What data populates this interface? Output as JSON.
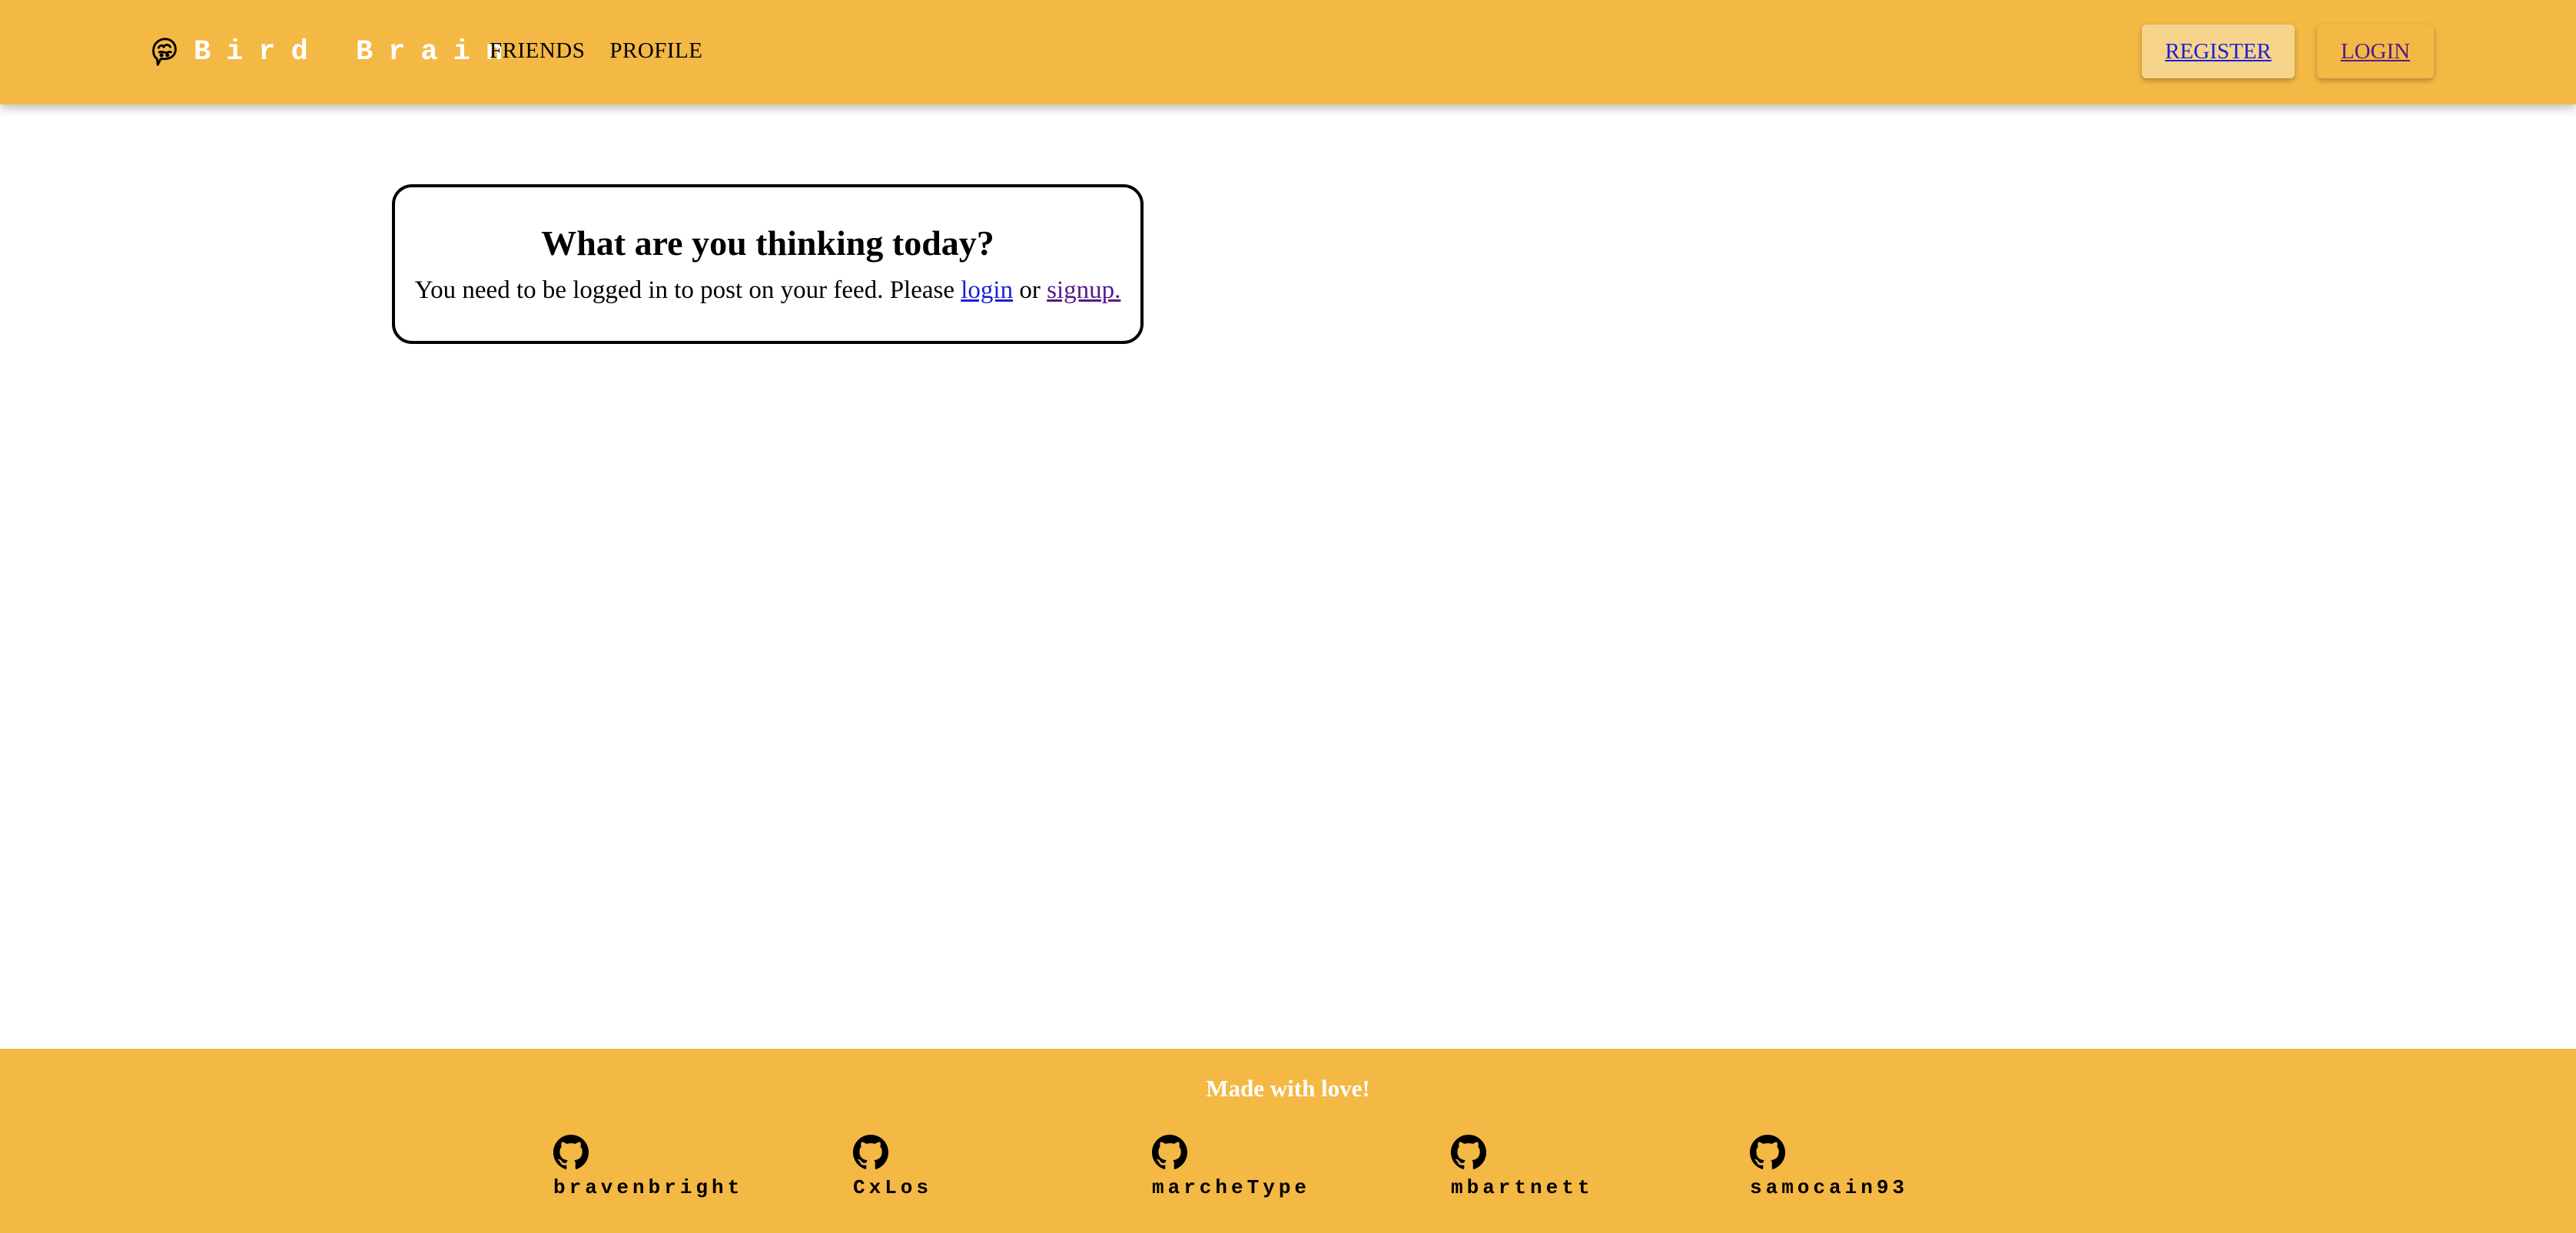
{
  "header": {
    "brand_name": "Bird Brain",
    "brand_icon": "bird-brain-logo-icon",
    "nav_links": [
      "FRIENDS",
      "PROFILE"
    ],
    "register_label": "REGISTER",
    "login_label": "LOGIN"
  },
  "main": {
    "card_title": "What are you thinking today?",
    "card_text": "You need to be logged in to post on your feed. Please",
    "login_link": "login",
    "or_text": "or",
    "signup_link": "signup."
  },
  "footer": {
    "title": "Made with love!",
    "contributors": [
      {
        "name": "bravenbright",
        "icon": "github-icon"
      },
      {
        "name": "CxLos",
        "icon": "github-icon"
      },
      {
        "name": "marcheType",
        "icon": "github-icon"
      },
      {
        "name": "mbartnett",
        "icon": "github-icon"
      },
      {
        "name": "samocain93",
        "icon": "github-icon"
      }
    ]
  },
  "colors": {
    "accent": "#f4b845",
    "register_button": "#f7d48c",
    "link": "#1b1fd4",
    "visited_link": "#551a8b"
  }
}
